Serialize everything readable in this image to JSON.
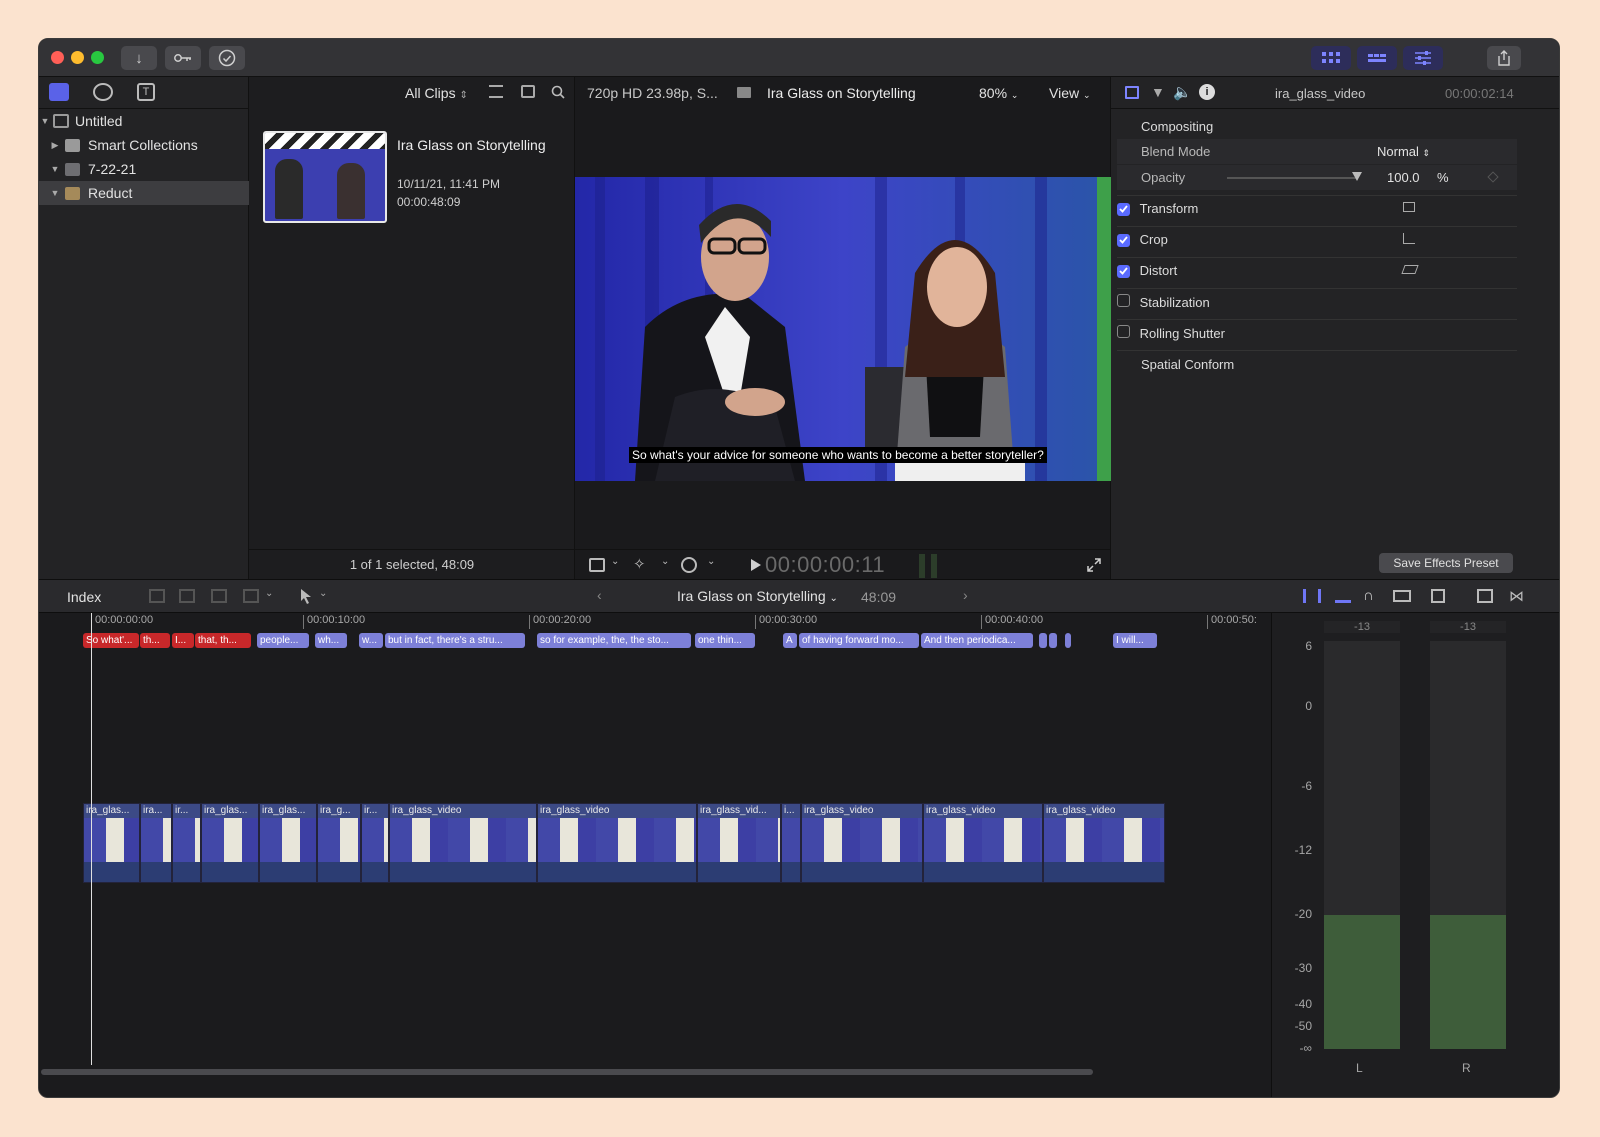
{
  "toolbar": {
    "import_icon": "↓",
    "keywords_icon": "key",
    "bg_tasks_icon": "✓"
  },
  "library": {
    "root": "Untitled",
    "items": [
      {
        "label": "Smart Collections",
        "expanded": false
      },
      {
        "label": "7-22-21",
        "expanded": true
      },
      {
        "label": "Reduct",
        "expanded": true,
        "selected": true
      }
    ]
  },
  "browser": {
    "filter": "All Clips",
    "clip_title": "Ira Glass on Storytelling",
    "clip_date": "10/11/21, 11:41 PM",
    "clip_duration": "00:00:48:09",
    "status": "1 of 1 selected, 48:09"
  },
  "viewer": {
    "format": "720p HD 23.98p, S...",
    "project": "Ira Glass on Storytelling",
    "zoom": "80%",
    "view_menu": "View",
    "caption": "So what's your advice for someone who wants to become a better storyteller?",
    "timecode": "00:00:00:11"
  },
  "inspector": {
    "clip_name": "ira_glass_video",
    "duration": "00:00:02:14",
    "compositing": "Compositing",
    "blend_mode_label": "Blend Mode",
    "blend_mode_value": "Normal",
    "opacity_label": "Opacity",
    "opacity_value": "100.0",
    "opacity_unit": "%",
    "opacity_level": 1.0,
    "sections": [
      {
        "label": "Transform",
        "checked": true
      },
      {
        "label": "Crop",
        "checked": true
      },
      {
        "label": "Distort",
        "checked": true
      },
      {
        "label": "Stabilization",
        "checked": false
      },
      {
        "label": "Rolling Shutter",
        "checked": false
      }
    ],
    "spatial_conform": "Spatial Conform",
    "save_button": "Save Effects Preset"
  },
  "timeline": {
    "index_label": "Index",
    "project": "Ira Glass on Storytelling",
    "duration": "48:09",
    "ruler": [
      "00:00:00:00",
      "00:00:10:00",
      "00:00:20:00",
      "00:00:30:00",
      "00:00:40:00",
      "00:00:50:"
    ],
    "captions": [
      {
        "text": "So what'...",
        "color": "red"
      },
      {
        "text": "th...",
        "color": "red"
      },
      {
        "text": "I...",
        "color": "red"
      },
      {
        "text": "that, th...",
        "color": "red"
      },
      {
        "text": "people...",
        "color": "purple"
      },
      {
        "text": "wh...",
        "color": "purple"
      },
      {
        "text": "w...",
        "color": "purple"
      },
      {
        "text": "but in fact, there's a stru...",
        "color": "purple"
      },
      {
        "text": "so for example, the, the sto...",
        "color": "purple"
      },
      {
        "text": "one thin...",
        "color": "purple"
      },
      {
        "text": "A",
        "color": "purple"
      },
      {
        "text": "of having forward mo...",
        "color": "purple"
      },
      {
        "text": "And then periodica...",
        "color": "purple"
      },
      {
        "text": "",
        "color": "purple"
      },
      {
        "text": "",
        "color": "purple"
      },
      {
        "text": "",
        "color": "purple"
      },
      {
        "text": "I will...",
        "color": "purple"
      }
    ],
    "clips": [
      "ira_glas...",
      "ira...",
      "ir...",
      "ira_glas...",
      "ira_glas...",
      "ira_g...",
      "ir...",
      "ira_glass_video",
      "ira_glass_video",
      "ira_glass_vid...",
      "i...",
      "ira_glass_video",
      "ira_glass_video",
      "ira_glass_video"
    ]
  },
  "meters": {
    "peak_left": "-13",
    "peak_right": "-13",
    "scale": [
      "6",
      "0",
      "-6",
      "-12",
      "-20",
      "-30",
      "-40",
      "-50",
      "-∞"
    ],
    "channels": [
      "L",
      "R"
    ],
    "level_db": -20
  }
}
